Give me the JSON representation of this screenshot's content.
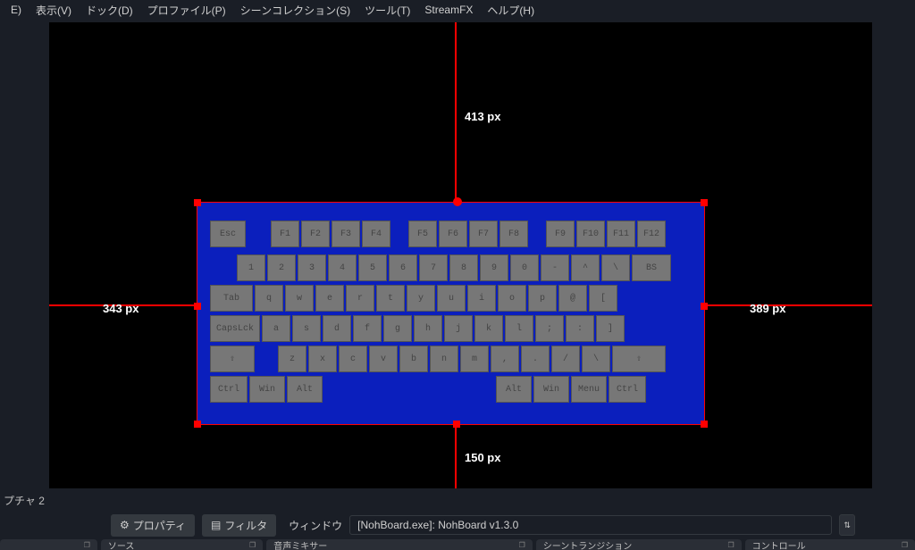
{
  "menu": {
    "edit": "E)",
    "view": "表示(V)",
    "dock": "ドック(D)",
    "profile": "プロファイル(P)",
    "scenes": "シーンコレクション(S)",
    "tools": "ツール(T)",
    "streamfx": "StreamFX",
    "help": "ヘルプ(H)"
  },
  "guides": {
    "top": "413 px",
    "left": "343 px",
    "right": "389 px",
    "bottom": "150 px"
  },
  "keyboard": {
    "r1": [
      "Esc",
      "",
      "F1",
      "F2",
      "F3",
      "F4",
      "",
      "F5",
      "F6",
      "F7",
      "F8",
      "",
      "F9",
      "F10",
      "F11",
      "F12"
    ],
    "r2": [
      "",
      "1",
      "2",
      "3",
      "4",
      "5",
      "6",
      "7",
      "8",
      "9",
      "0",
      "-",
      "^",
      "\\",
      "BS"
    ],
    "r3": [
      "Tab",
      "q",
      "w",
      "e",
      "r",
      "t",
      "y",
      "u",
      "i",
      "o",
      "p",
      "@",
      "[",
      ""
    ],
    "r4": [
      "CapsLck",
      "a",
      "s",
      "d",
      "f",
      "g",
      "h",
      "j",
      "k",
      "l",
      ";",
      ":",
      "]",
      ""
    ],
    "r5": [
      "⇧",
      "",
      "z",
      "x",
      "c",
      "v",
      "b",
      "n",
      "m",
      ",",
      ".",
      "/",
      "\\",
      "⇧"
    ],
    "r6": [
      "Ctrl",
      "Win",
      "Alt",
      "",
      "Alt",
      "Win",
      "Menu",
      "Ctrl"
    ]
  },
  "tabs": {
    "capture": "プチャ 2"
  },
  "toolbar": {
    "props": "プロパティ",
    "filters": "フィルタ",
    "window_label": "ウィンドウ",
    "window_value": "[NohBoard.exe]: NohBoard v1.3.0"
  },
  "docks": {
    "d1": "",
    "d2": "ソース",
    "d3": "音声ミキサー",
    "d4": "シーントランジション",
    "d5": "コントロール"
  },
  "icons": {
    "gear": "⚙",
    "filter": "▤",
    "updown": "⇅",
    "restore": "❐"
  }
}
